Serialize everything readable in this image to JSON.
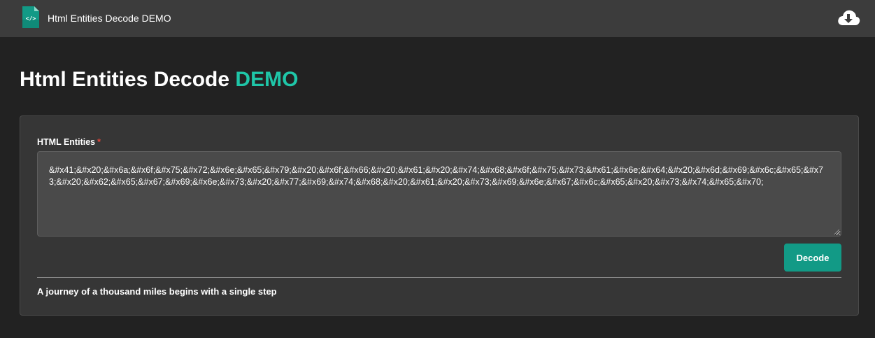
{
  "header": {
    "app_title": "Html Entities Decode DEMO",
    "logo_icon": "code-file-icon",
    "download_icon": "cloud-download-icon",
    "accent_color": "#1fc6a8"
  },
  "main": {
    "heading_prefix": "Html Entities Decode",
    "heading_accent": "DEMO"
  },
  "form": {
    "label": "HTML Entities",
    "required_marker": "*",
    "input_value": "&#x41;&#x20;&#x6a;&#x6f;&#x75;&#x72;&#x6e;&#x65;&#x79;&#x20;&#x6f;&#x66;&#x20;&#x61;&#x20;&#x74;&#x68;&#x6f;&#x75;&#x73;&#x61;&#x6e;&#x64;&#x20;&#x6d;&#x69;&#x6c;&#x65;&#x73;&#x20;&#x62;&#x65;&#x67;&#x69;&#x6e;&#x73;&#x20;&#x77;&#x69;&#x74;&#x68;&#x20;&#x61;&#x20;&#x73;&#x69;&#x6e;&#x67;&#x6c;&#x65;&#x20;&#x73;&#x74;&#x65;&#x70;",
    "decode_label": "Decode",
    "button_color": "#129a86"
  },
  "result": {
    "text": "A journey of a thousand miles begins with a single step"
  }
}
